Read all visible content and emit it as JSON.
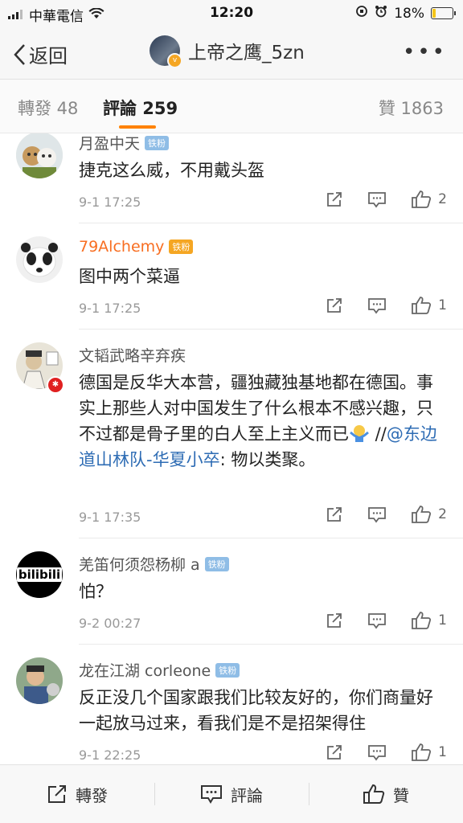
{
  "status_bar": {
    "carrier": "中華電信",
    "time": "12:20",
    "battery": "18%",
    "battery_level": 0.18
  },
  "nav": {
    "back_label": "返回",
    "title": "上帝之鹰_5zn"
  },
  "tabs": {
    "repost": "轉發 48",
    "comments": "評論 259",
    "likes": "贊 1863"
  },
  "fan_badge": "铁粉",
  "comments": [
    {
      "user": "月盈中天",
      "text": "捷克这么威，不用戴头盔",
      "time": "9-1 17:25",
      "likes": "2"
    },
    {
      "user": "79Alchemy",
      "text": "图中两个菜逼",
      "time": "9-1 17:25",
      "likes": "1"
    },
    {
      "user": "文韬武略辛弃疾",
      "text": "德国是反华大本营，疆独藏独基地都在德国。事实上那些人对中国发生了什么根本不感兴趣，只不过都是骨子里的白人至上主义而已",
      "text_slashes": " //",
      "mention": "@东边道山林队-华夏小卒",
      "text_tail": ": 物以类聚。",
      "time": "9-1 17:35",
      "likes": "2"
    },
    {
      "user": "羌笛何须怨杨柳 a",
      "text": "怕？",
      "time": "9-2 00:27",
      "likes": "1"
    },
    {
      "user": "龙在江湖 corleone",
      "text": "反正没几个国家跟我们比较友好的，你们商量好一起放马过来，看我们是不是招架得住",
      "time": "9-1 22:25",
      "likes": "1"
    }
  ],
  "avatar_text": {
    "bili": "bilibili"
  },
  "bottom_bar": {
    "repost": "轉發",
    "comment": "評論",
    "like": "贊"
  }
}
